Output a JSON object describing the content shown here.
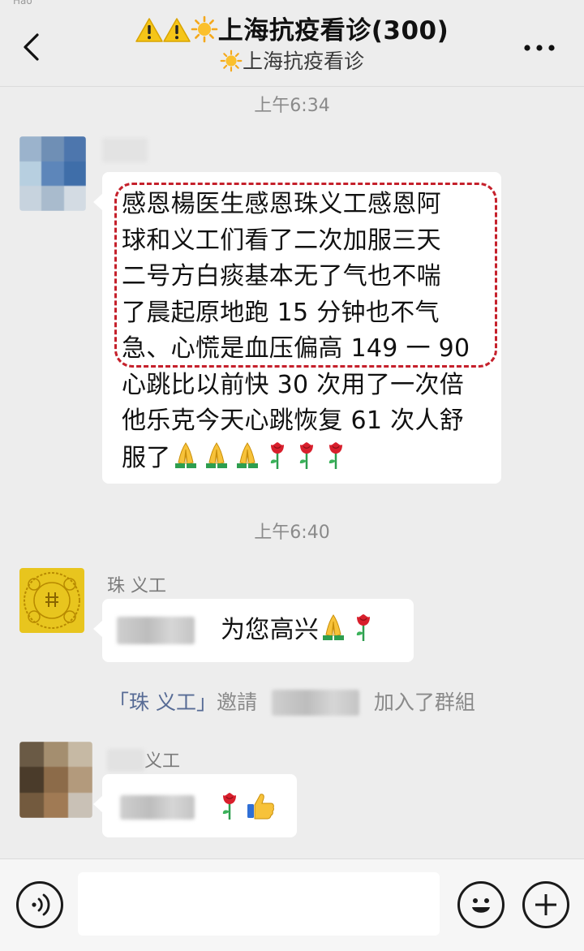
{
  "status_bar": {
    "text": "Hao"
  },
  "header": {
    "title": "上海抗疫看诊(300)",
    "subtitle": "上海抗疫看诊",
    "back_icon": "chevron-left-icon",
    "more_icon": "more-dots-icon"
  },
  "messages": [
    {
      "type": "timestamp",
      "time": "上午6:34"
    },
    {
      "type": "message",
      "sender": "",
      "lines": [
        "感恩楊医生感恩珠义工感恩阿",
        "球和义工们看了二次加服三天",
        "二号方白痰基本无了气也不喘",
        "了晨起原地跑 15 分钟也不气",
        "急、心慌是血压偏高 149 一 90",
        "心跳比以前快 30 次用了一次倍",
        "他乐克今天心跳恢复 61 次人舒",
        "服了"
      ],
      "trailing_emojis": [
        "pray-emoji",
        "pray-emoji",
        "pray-emoji",
        "rose-emoji",
        "rose-emoji",
        "rose-emoji"
      ],
      "highlighted_lines": 5,
      "highlight_color": "#c5202b"
    },
    {
      "type": "timestamp",
      "time": "上午6:40"
    },
    {
      "type": "message",
      "sender": "珠  义工",
      "text": "为您高兴",
      "trailing_emojis": [
        "pray-emoji",
        "rose-emoji"
      ]
    },
    {
      "type": "system",
      "inviter": "「珠  义工」",
      "verb": "邀請",
      "suffix": "加入了群組"
    },
    {
      "type": "message",
      "sender": "义工",
      "text": "",
      "trailing_emojis": [
        "rose-emoji",
        "thumbs-up-emoji"
      ]
    }
  ],
  "input_bar": {
    "voice_icon": "voice-icon",
    "emoji_icon": "smiley-icon",
    "plus_icon": "plus-icon",
    "placeholder": ""
  },
  "colors": {
    "background": "#ededed",
    "bubble": "#ffffff",
    "link": "#576b95",
    "timestamp": "#8a8a8a",
    "highlight": "#c5202b"
  }
}
